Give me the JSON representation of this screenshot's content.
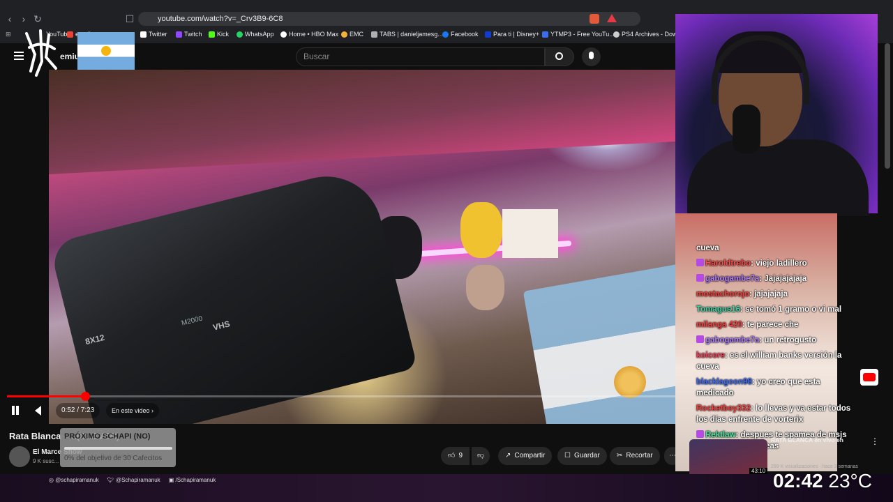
{
  "browser": {
    "url": "youtube.com/watch?v=_Crv3B9-6C8",
    "bookmarks": [
      {
        "label": "Twitter",
        "color": "#ffffff"
      },
      {
        "label": "Twitch",
        "color": "#9146ff"
      },
      {
        "label": "Kick",
        "color": "#53fc18"
      },
      {
        "label": "WhatsApp",
        "color": "#25d366"
      },
      {
        "label": "Home • HBO Max",
        "color": "#ffffff"
      },
      {
        "label": "EMC",
        "color": "#f3b13a"
      },
      {
        "label": "TABS | danieljamesg...",
        "color": "#b0b0b0"
      },
      {
        "label": "Facebook",
        "color": "#1877f2"
      },
      {
        "label": "Para ti | Disney+",
        "color": "#113ccf"
      },
      {
        "label": "YTMP3 - Free YouTu...",
        "color": "#3a6df0"
      },
      {
        "label": "PS4 Archives - Dow...",
        "color": "#cccccc"
      }
    ],
    "bookmark_partial": [
      "YouTube",
      "email"
    ]
  },
  "youtube": {
    "logo_partial": "emium",
    "search_placeholder": "Buscar"
  },
  "player": {
    "time": "0:52 / 7:23",
    "chapter": "En este video",
    "progress_fraction": 0.117,
    "camera_label": "M2000",
    "camera_brand": "VHS",
    "camera_model": "8X12"
  },
  "video": {
    "title": "Rata Blanca - ...(CLEVER)",
    "channel": "El Marce Show",
    "subs": "9 K susc...",
    "subscribe": "Suscribirme",
    "like_count": "9",
    "share": "Compartir",
    "save": "Guardar",
    "clip": "Recortar"
  },
  "overlay_goal": {
    "title": "PRÓXIMO SCHAPI (NO)",
    "subtitle": "0% del objetivo de 30 Cafecitos"
  },
  "chat": [
    {
      "user": "",
      "text": "cueva",
      "user_color": "#ffffff",
      "badge": ""
    },
    {
      "user": "Haroldtrebo",
      "text": ": viejo ladillero",
      "user_color": "#ff4a4a",
      "badge": "#b54ae6"
    },
    {
      "user": "gabogambe7a",
      "text": ": Jajajajajaja",
      "user_color": "#b07cff",
      "badge": "#b54ae6"
    },
    {
      "user": "mostachorojo",
      "text": ": jajajajaja",
      "user_color": "#ff3b3b",
      "badge": ""
    },
    {
      "user": "Tomagus16",
      "text": ": se tomó 1 gramo o vi mal",
      "user_color": "#3cd6a8",
      "badge": ""
    },
    {
      "user": "milanga 420",
      "text": ": te parece che",
      "user_color": "#ff3b3b",
      "badge": ""
    },
    {
      "user": "gabogambe7a",
      "text": ": un retrogusto",
      "user_color": "#b07cff",
      "badge": "#b54ae6"
    },
    {
      "user": "koicore",
      "text": ": es el william banks versión la cueva",
      "user_color": "#ff3b5b",
      "badge": ""
    },
    {
      "user": "blacklagoon98",
      "text": ": yo creo que esta medicado",
      "user_color": "#3b6bff",
      "badge": ""
    },
    {
      "user": "Rocketboy332",
      "text": ": lo llevas y va estar todos los días enfrente de vorterix",
      "user_color": "#ff3b3b",
      "badge": ""
    },
    {
      "user": "Rektlaw",
      "text": ": despues te spamea de msjs en ig para darte ideas",
      "user_color": "#4ae6a0",
      "badge": "#b54ae6"
    }
  ],
  "live_card": {
    "title": "RATA BLANCA en vivo en",
    "meta": "299 K visualizaciones · hace 3 semanas",
    "duration": "43:10"
  },
  "stream_overlay": {
    "clock": "02:42",
    "temp": "23°C",
    "instagram": "@schapiramanuk",
    "twitter": "@Schapiramanuk",
    "twitch": "/Schapiramanuk"
  },
  "colors": {
    "yt_red": "#ff0000",
    "bg": "#0f0f0f"
  }
}
